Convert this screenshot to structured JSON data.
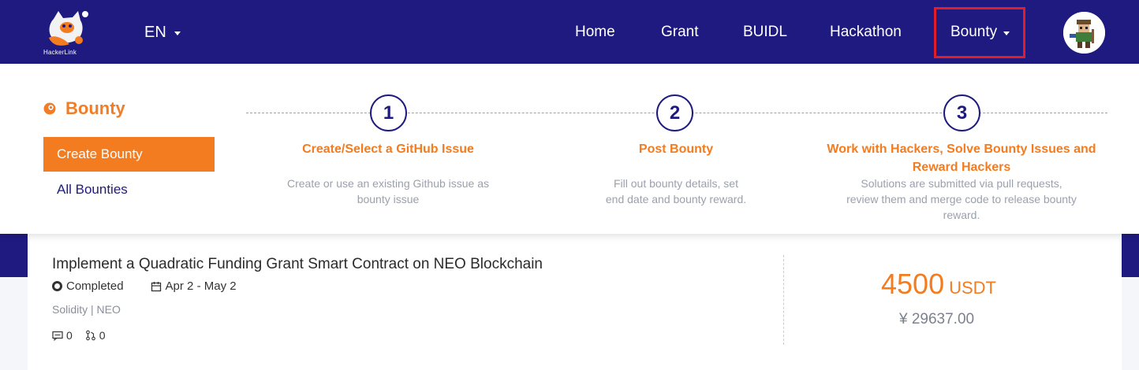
{
  "header": {
    "logo_text": "HackerLink",
    "language": "EN",
    "nav": [
      "Home",
      "Grant",
      "BUIDL",
      "Hackathon",
      "Bounty"
    ]
  },
  "bounty_menu": {
    "title": "Bounty",
    "create_label": "Create Bounty",
    "all_label": "All Bounties",
    "steps": [
      {
        "number": "1",
        "title": "Create/Select a GitHub Issue",
        "desc_lines": [
          "Create or use an existing Github issue as",
          "bounty issue"
        ]
      },
      {
        "number": "2",
        "title": "Post Bounty",
        "desc_lines": [
          "Fill out bounty details, set",
          "end date and bounty reward."
        ]
      },
      {
        "number": "3",
        "title_lines": [
          "Work with Hackers, Solve Bounty Issues and",
          "Reward Hackers"
        ],
        "desc_lines": [
          "Solutions are submitted via pull requests,",
          "review them and merge code to release bounty",
          "reward."
        ]
      }
    ]
  },
  "bounty_card": {
    "title": "Implement a Quadratic Funding Grant Smart Contract on NEO Blockchain",
    "status": "Completed",
    "date_range": "Apr 2 - May 2",
    "tags": "Solidity | NEO",
    "comments": "0",
    "pull_requests": "0",
    "amount": "4500",
    "currency": "USDT",
    "cny_amount": "¥ 29637.00"
  },
  "colors": {
    "brand_navy": "#1f1a80",
    "accent_orange": "#f47c20",
    "highlight_red": "#e11d2a"
  }
}
